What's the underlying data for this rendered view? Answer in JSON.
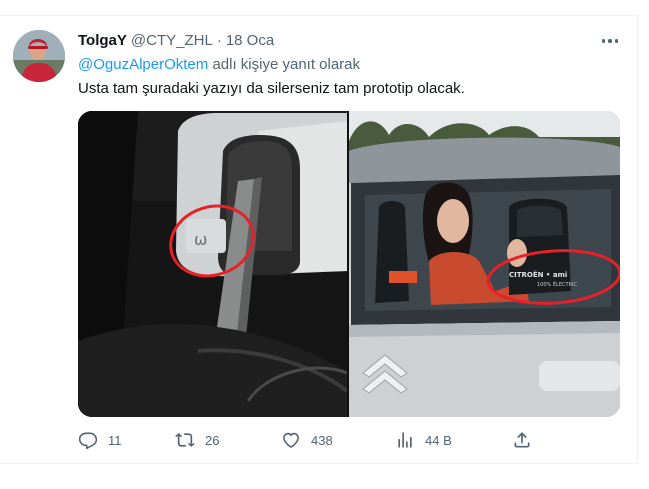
{
  "tweet": {
    "author": {
      "display_name": "TolgaY",
      "handle": "@CTY_ZHL",
      "avatar_icon": "user-avatar"
    },
    "separator": "·",
    "time": "18 Oca",
    "reply_to": {
      "mention": "@OguzAlperOktem",
      "suffix": " adlı kişiye yanıt olarak"
    },
    "text": "Usta tam şuradaki yazıyı da silerseniz tam prototip olacak.",
    "media": {
      "left_image_icon": "car-interior-photo",
      "right_image_icon": "car-advertisement-photo",
      "right_image_logo": "CITROËN • ami",
      "right_image_tagline": "100% ÉLECTRIC"
    },
    "actions": {
      "reply": {
        "icon": "reply-icon",
        "count": "11"
      },
      "retweet": {
        "icon": "retweet-icon",
        "count": "26"
      },
      "like": {
        "icon": "heart-icon",
        "count": "438"
      },
      "views": {
        "icon": "views-icon",
        "count": "44 B"
      },
      "share": {
        "icon": "share-icon"
      }
    },
    "more_icon": "more-icon"
  },
  "colors": {
    "text": "#0f1419",
    "secondary": "#536471",
    "link": "#1d9bf0",
    "divider": "#eff3f4",
    "annotation_circle": "#e8202a"
  }
}
